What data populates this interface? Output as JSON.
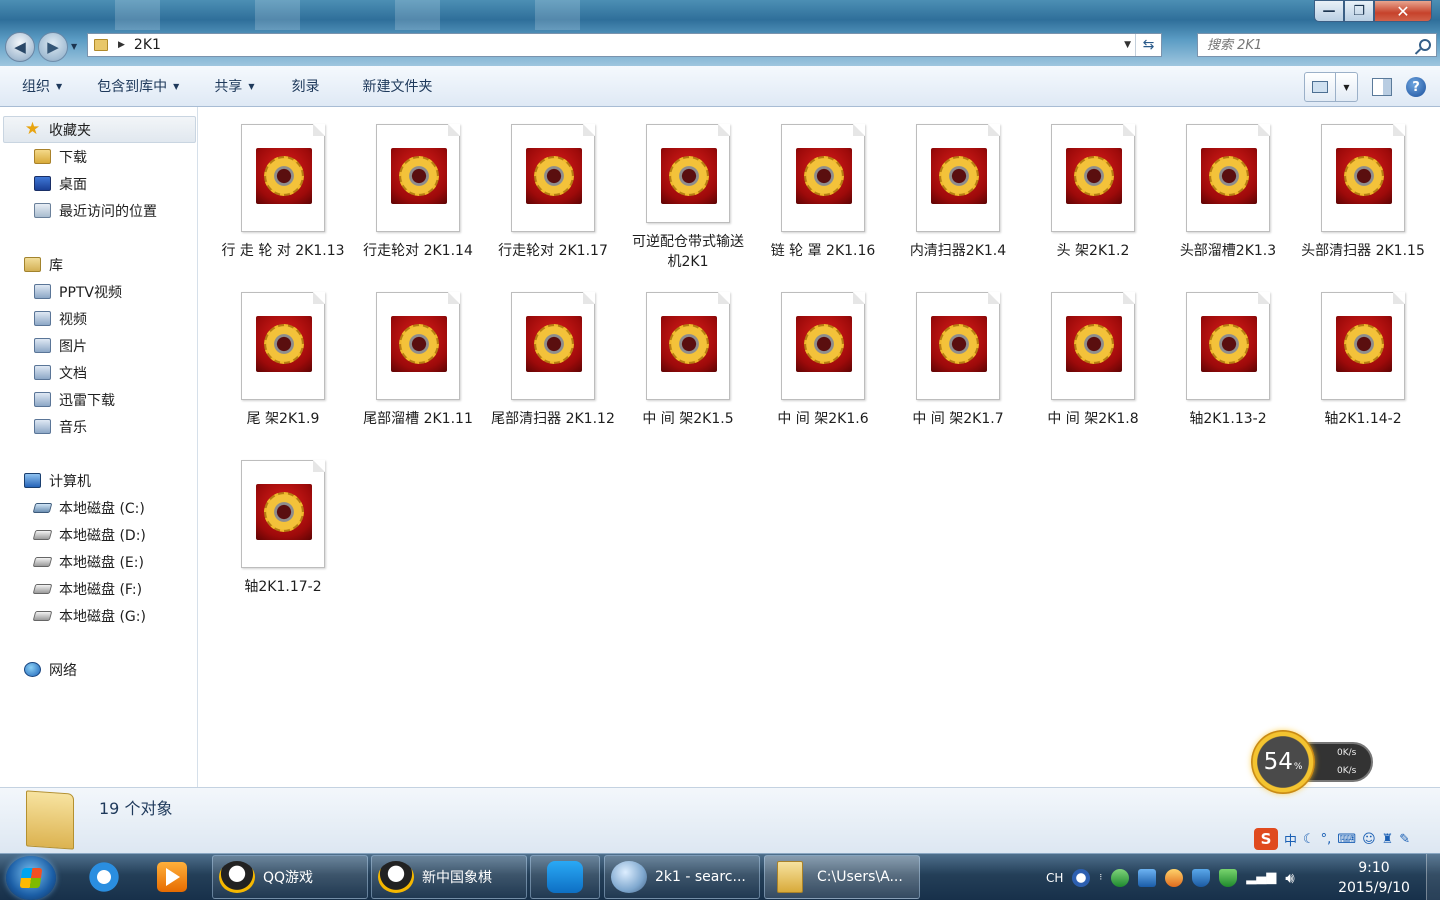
{
  "window": {
    "address_path": "2K1",
    "search_placeholder": "搜索 2K1",
    "controls": {
      "minimize": "—",
      "maximize": "❐",
      "close": "✕"
    }
  },
  "toolbar": {
    "organize": "组织",
    "include_in_library": "包含到库中",
    "share": "共享",
    "burn": "刻录",
    "new_folder": "新建文件夹"
  },
  "navpane": {
    "favorites": {
      "label": "收藏夹",
      "items": [
        {
          "label": "下载",
          "icon": "download-folder-icon"
        },
        {
          "label": "桌面",
          "icon": "desktop-icon"
        },
        {
          "label": "最近访问的位置",
          "icon": "recent-places-icon"
        }
      ]
    },
    "libraries": {
      "label": "库",
      "items": [
        {
          "label": "PPTV视频"
        },
        {
          "label": "视频"
        },
        {
          "label": "图片"
        },
        {
          "label": "文档"
        },
        {
          "label": "迅雷下载"
        },
        {
          "label": "音乐"
        }
      ]
    },
    "computer": {
      "label": "计算机",
      "drives": [
        {
          "label": "本地磁盘 (C:)"
        },
        {
          "label": "本地磁盘 (D:)"
        },
        {
          "label": "本地磁盘 (E:)"
        },
        {
          "label": "本地磁盘 (F:)"
        },
        {
          "label": "本地磁盘 (G:)"
        }
      ]
    },
    "network": {
      "label": "网络"
    }
  },
  "files": [
    {
      "name": "行 走 轮 对 2K1.13"
    },
    {
      "name": "行走轮对 2K1.14"
    },
    {
      "name": "行走轮对 2K1.17"
    },
    {
      "name": "可逆配仓带式输送机2K1"
    },
    {
      "name": "链 轮 罩 2K1.16"
    },
    {
      "name": "内清扫器2K1.4"
    },
    {
      "name": "头 架2K1.2"
    },
    {
      "name": "头部溜槽2K1.3"
    },
    {
      "name": "头部清扫器 2K1.15"
    },
    {
      "name": "尾 架2K1.9"
    },
    {
      "name": "尾部溜槽 2K1.11"
    },
    {
      "name": "尾部清扫器 2K1.12"
    },
    {
      "name": "中 间 架2K1.5"
    },
    {
      "name": "中 间 架2K1.6"
    },
    {
      "name": "中 间 架2K1.7"
    },
    {
      "name": "中 间 架2K1.8"
    },
    {
      "name": "轴2K1.13-2"
    },
    {
      "name": "轴2K1.14-2"
    },
    {
      "name": "轴2K1.17-2"
    }
  ],
  "details": {
    "count_text": "19 个对象"
  },
  "speed_widget": {
    "percent": "54",
    "percent_sign": "%",
    "up": "0K/s",
    "down": "0K/s"
  },
  "ime": {
    "logo": "S",
    "mode": "中"
  },
  "taskbar": {
    "tasks": [
      {
        "label": "QQ游戏",
        "icon": "qq-icon"
      },
      {
        "label": "新中国象棋",
        "icon": "qq-icon"
      },
      {
        "label": "",
        "icon": "cloud-icon"
      },
      {
        "label": "2k1 - searc...",
        "icon": "search-magnifier-icon"
      },
      {
        "label": "C:\\Users\\A...",
        "icon": "folder-icon"
      }
    ],
    "tray": {
      "language": "CH"
    },
    "clock": {
      "time": "9:10",
      "date": "2015/9/10"
    }
  }
}
